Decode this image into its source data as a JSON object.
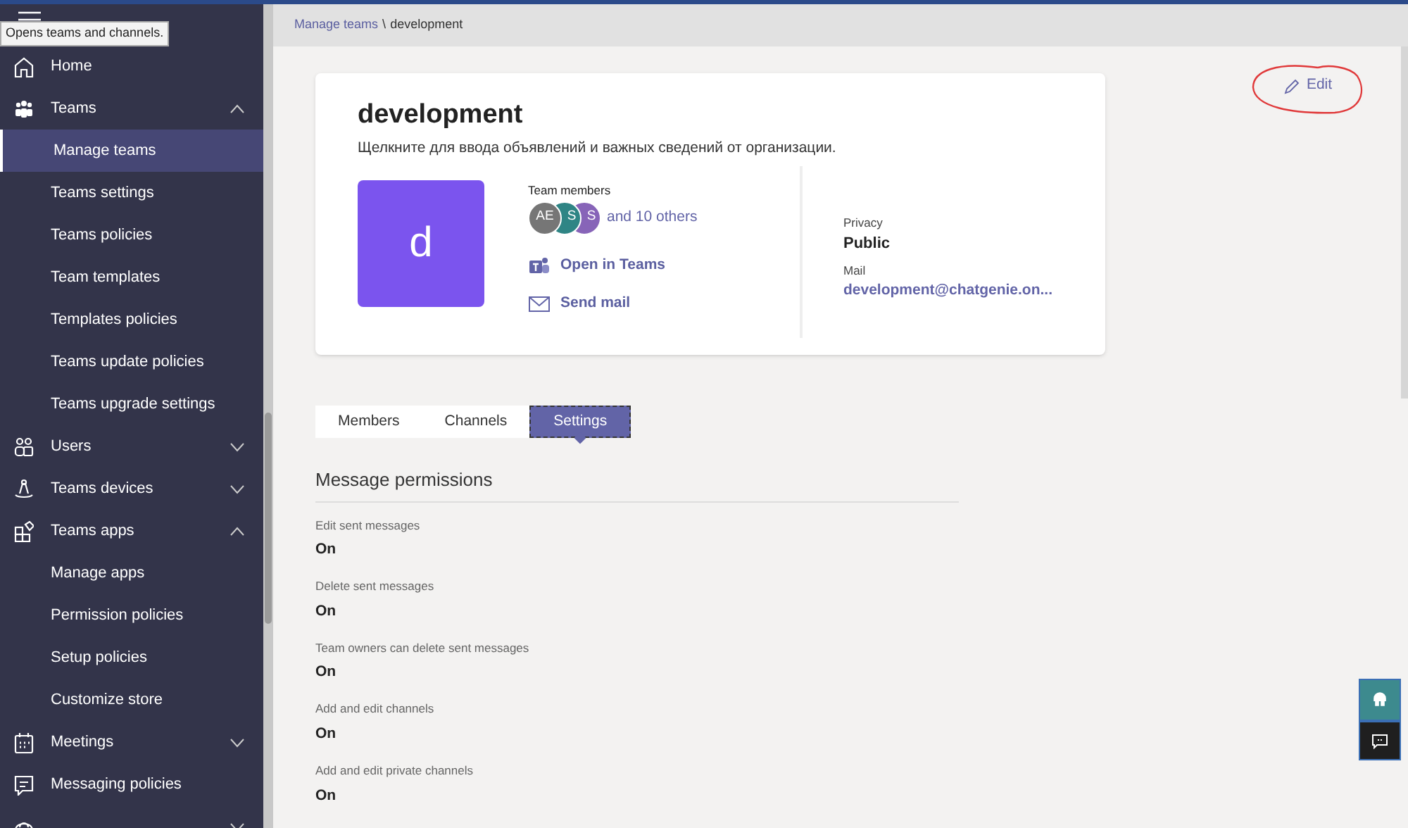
{
  "tooltip": "Opens teams and channels.",
  "sidebar": {
    "items": [
      {
        "label": "Home",
        "selected": false
      },
      {
        "label": "Teams",
        "selected": false,
        "expanded": true,
        "children": [
          {
            "label": "Manage teams",
            "selected": true
          },
          {
            "label": "Teams settings",
            "selected": false
          },
          {
            "label": "Teams policies",
            "selected": false
          },
          {
            "label": "Team templates",
            "selected": false
          },
          {
            "label": "Templates policies",
            "selected": false
          },
          {
            "label": "Teams update policies",
            "selected": false
          },
          {
            "label": "Teams upgrade settings",
            "selected": false
          }
        ]
      },
      {
        "label": "Users",
        "selected": false,
        "expanded": false
      },
      {
        "label": "Teams devices",
        "selected": false,
        "expanded": false
      },
      {
        "label": "Teams apps",
        "selected": false,
        "expanded": true,
        "children": [
          {
            "label": "Manage apps",
            "selected": false
          },
          {
            "label": "Permission policies",
            "selected": false
          },
          {
            "label": "Setup policies",
            "selected": false
          },
          {
            "label": "Customize store",
            "selected": false
          }
        ]
      },
      {
        "label": "Meetings",
        "selected": false,
        "expanded": false
      },
      {
        "label": "Messaging policies",
        "selected": false
      },
      {
        "selected": false,
        "expanded": false
      }
    ]
  },
  "breadcrumb": [
    {
      "label": "Manage teams",
      "kind": "link"
    },
    {
      "label": "\\",
      "kind": "separator"
    },
    {
      "label": "development",
      "kind": "current"
    }
  ],
  "edit_button": "Edit",
  "team": {
    "name": "development",
    "description": "Щелкните для ввода объявлений и важных сведений от организации.",
    "avatar_letter": "d",
    "members_label": "Team members",
    "members": [
      {
        "initials": "AE",
        "color": "#767676"
      },
      {
        "initials": "S",
        "color": "#2f8585"
      },
      {
        "initials": "S",
        "color": "#8764b8"
      }
    ],
    "others": "and 10 others",
    "actions": [
      {
        "label": "Open in Teams"
      },
      {
        "label": "Send mail"
      }
    ],
    "privacy_label": "Privacy",
    "privacy": "Public",
    "mail_label": "Mail",
    "mail": "development@chatgenie.on..."
  },
  "tabs": [
    {
      "label": "Members",
      "selected": false
    },
    {
      "label": "Channels",
      "selected": false
    },
    {
      "label": "Settings",
      "selected": true
    }
  ],
  "section_title": "Message permissions",
  "settings": [
    {
      "label": "Edit sent messages",
      "value": "On"
    },
    {
      "label": "Delete sent messages",
      "value": "On"
    },
    {
      "label": "Team owners can delete sent messages",
      "value": "On"
    },
    {
      "label": "Add and edit channels",
      "value": "On"
    },
    {
      "label": "Add and edit private channels",
      "value": "On"
    }
  ]
}
